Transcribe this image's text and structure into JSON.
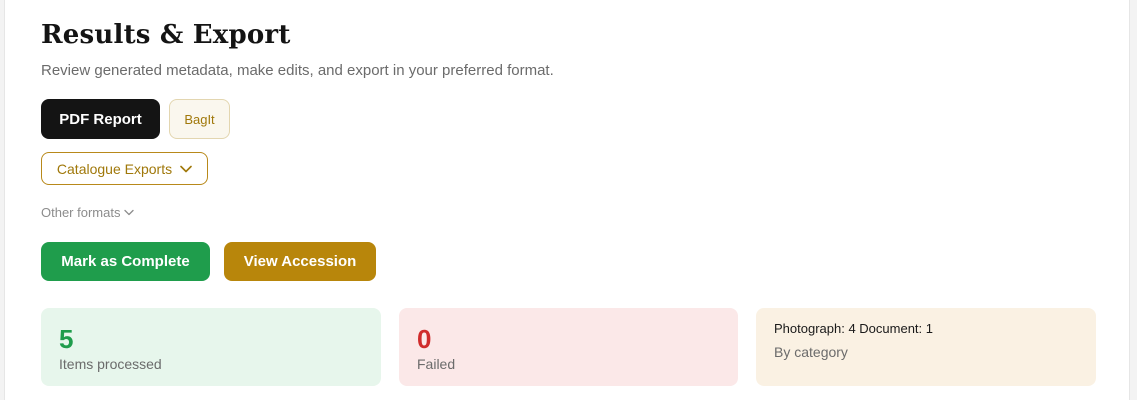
{
  "header": {
    "title": "Results & Export",
    "subtitle": "Review generated metadata, make edits, and export in your preferred format."
  },
  "export_buttons": {
    "pdf_label": "PDF Report",
    "bagit_label": "BagIt",
    "catalogue_label": "Catalogue Exports",
    "other_formats_label": "Other formats"
  },
  "actions": {
    "complete_label": "Mark as Complete",
    "accession_label": "View Accession"
  },
  "stats": {
    "processed": {
      "value": "5",
      "label": "Items processed"
    },
    "failed": {
      "value": "0",
      "label": "Failed"
    },
    "category": {
      "summary": "Photograph: 4 Document: 1",
      "label": "By category"
    }
  },
  "colors": {
    "primary_dark": "#141414",
    "accent_gold": "#b8860b",
    "success_green": "#1f9d4c",
    "danger_red": "#d02b2b"
  },
  "icons": {
    "catalogue_dropdown": "chevron-down-icon",
    "other_formats_toggle": "chevron-down-icon"
  }
}
